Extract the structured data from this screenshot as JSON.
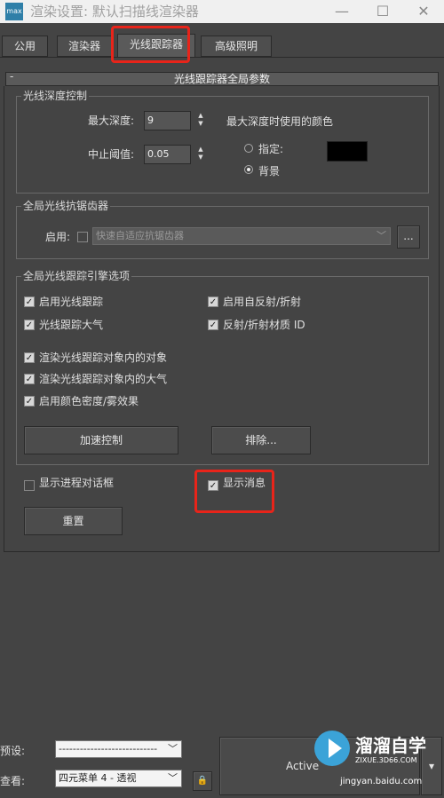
{
  "window": {
    "title": "渲染设置: 默认扫描线渲染器",
    "icon_text": "max",
    "minimize_glyph": "—",
    "maximize_glyph": "☐",
    "close_glyph": "✕"
  },
  "tabs": [
    {
      "label": "公用",
      "active": false
    },
    {
      "label": "渲染器",
      "active": false
    },
    {
      "label": "光线跟踪器",
      "active": true
    },
    {
      "label": "高级照明",
      "active": false
    }
  ],
  "rollout": {
    "title": "光线跟踪器全局参数",
    "collapse_glyph": "-"
  },
  "depth_control": {
    "legend": "光线深度控制",
    "max_depth_label": "最大深度:",
    "max_depth_value": "9",
    "cutoff_label": "中止阈值:",
    "cutoff_value": "0.05",
    "max_depth_color_label": "最大深度时使用的颜色",
    "specify_label": "指定:",
    "background_label": "背景",
    "selected_option": "背景",
    "swatch_color": "#000000"
  },
  "antialias": {
    "legend": "全局光线抗锯齿器",
    "enable_label": "启用:",
    "enabled": false,
    "selected": "快速自适应抗锯齿器",
    "more_label": "..."
  },
  "engine_options": {
    "legend": "全局光线跟踪引擎选项",
    "options": [
      {
        "label": "启用光线跟踪",
        "checked": true
      },
      {
        "label": "启用自反射/折射",
        "checked": true
      },
      {
        "label": "光线跟踪大气",
        "checked": true
      },
      {
        "label": "反射/折射材质 ID",
        "checked": true
      },
      {
        "label": "渲染光线跟踪对象内的对象",
        "checked": true
      },
      {
        "label": "渲染光线跟踪对象内的大气",
        "checked": true
      },
      {
        "label": "启用颜色密度/雾效果",
        "checked": true
      }
    ],
    "accel_button": "加速控制",
    "exclude_button": "排除..."
  },
  "bottom": {
    "show_progress_label": "显示进程对话框",
    "show_progress_checked": false,
    "show_messages_label": "显示消息",
    "show_messages_checked": true,
    "reset_button": "重置"
  },
  "footer": {
    "preset_label": "预设:",
    "preset_value": "----------------------------",
    "view_label": "查看:",
    "view_value": "四元菜单 4 - 透视",
    "active_label": "Active",
    "render_dropdown_glyph": "▾"
  },
  "watermark": {
    "name": "溜溜自学",
    "site": "ZIXUE.3D66.COM",
    "source": "jingyan.baidu.com"
  },
  "colors": {
    "highlight": "#e8241a",
    "panel_bg": "#444444"
  }
}
